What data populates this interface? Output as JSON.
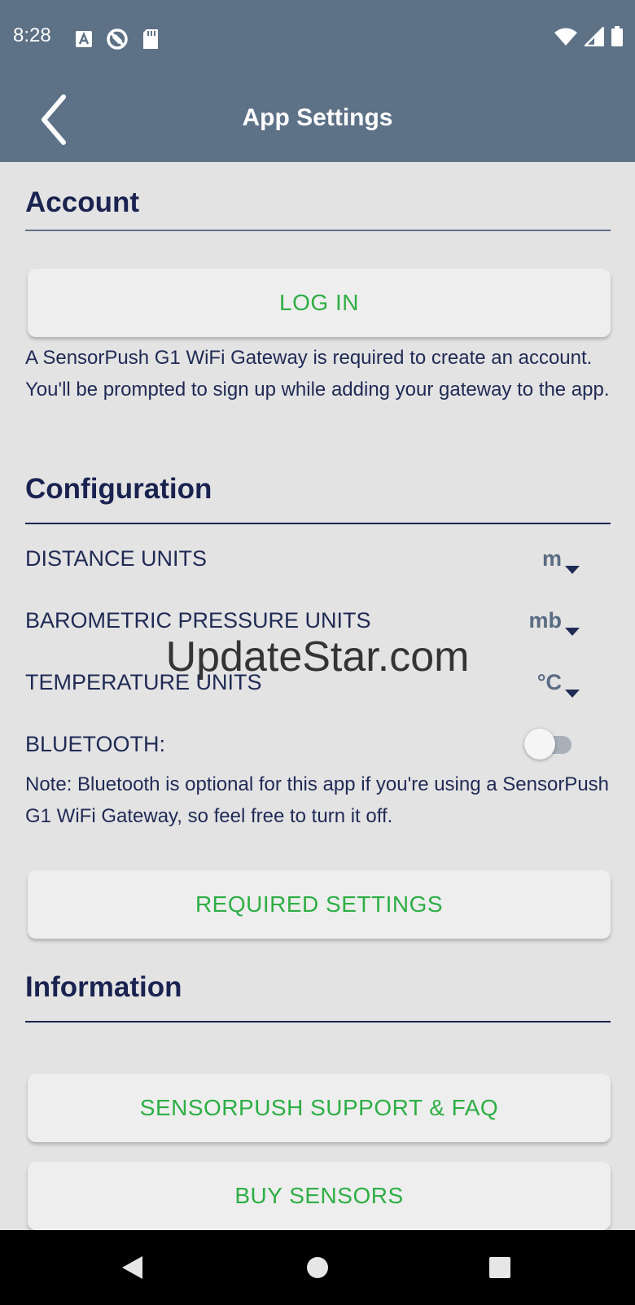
{
  "status_bar": {
    "time": "8:28",
    "left_icons": [
      "a-notification-icon",
      "blocked-icon",
      "sd-card-icon"
    ],
    "right_icons": [
      "wifi-icon",
      "signal-icon",
      "battery-icon"
    ]
  },
  "app_bar": {
    "title": "App Settings",
    "back_icon": "chevron-left-icon"
  },
  "sections": {
    "account": {
      "title": "Account",
      "login_label": "LOG IN",
      "note": "A SensorPush G1 WiFi Gateway is required to create an account. You'll be prompted to sign up while adding your gateway to the app."
    },
    "configuration": {
      "title": "Configuration",
      "distance_label": "DISTANCE UNITS",
      "distance_value": "m",
      "pressure_label": "BAROMETRIC PRESSURE UNITS",
      "pressure_value": "mb",
      "temperature_label": "TEMPERATURE UNITS",
      "temperature_value": "°C",
      "bluetooth_label": "BLUETOOTH:",
      "bluetooth_enabled": false,
      "bluetooth_note": "Note: Bluetooth is optional for this app if you're using a SensorPush G1 WiFi Gateway, so feel free to turn it off.",
      "required_settings_label": "REQUIRED SETTINGS"
    },
    "information": {
      "title": "Information",
      "support_label": "SENSORPUSH SUPPORT & FAQ",
      "buy_label": "BUY SENSORS"
    }
  },
  "watermark": "UpdateStar.com",
  "colors": {
    "app_bar": "#5d7187",
    "background": "#e3e3e3",
    "heading": "#1a2350",
    "button_text": "#2eae44"
  }
}
